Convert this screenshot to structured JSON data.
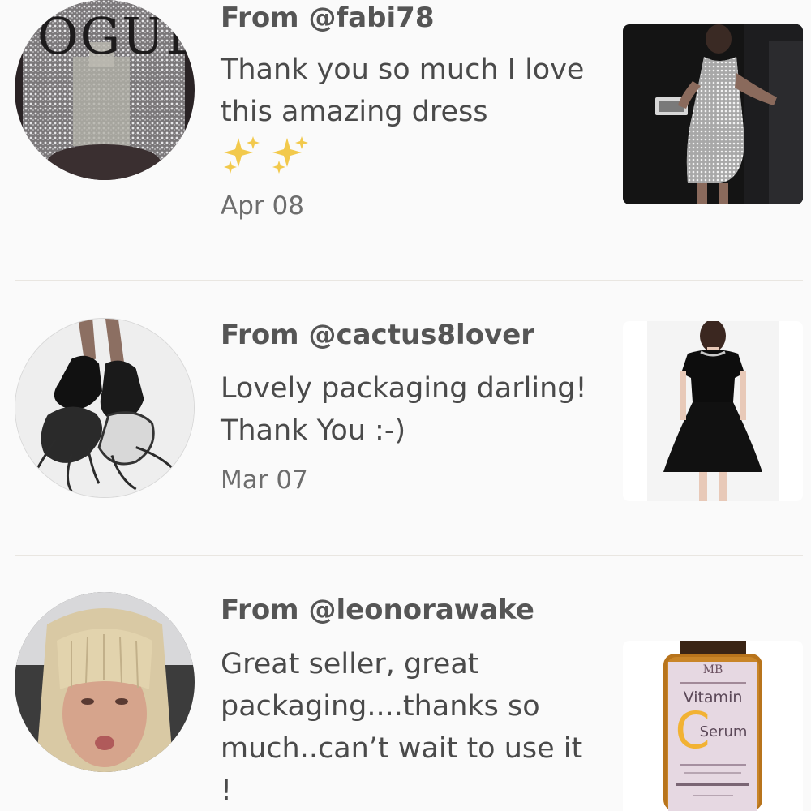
{
  "reviews": [
    {
      "from": "From @fabi78",
      "message": "Thank you so much I love this amazing dress",
      "emoji": "✨✨",
      "date": "Apr 08",
      "avatar_text": "VOGUE",
      "avatar_icon": "vogue-cover-avatar",
      "product_icon": "silver-sequin-dress-photo"
    },
    {
      "from": "From @cactus8lover",
      "message": "Lovely packaging darling! Thank You :-)",
      "date": "Mar 07",
      "avatar_icon": "sculptural-shoes-avatar",
      "product_icon": "black-dress-photo"
    },
    {
      "from": "From @leonorawake",
      "message": "Great seller, great packaging....thanks so much..can’t wait to use it !",
      "avatar_icon": "blonde-woman-avatar",
      "product_icon": "vitamin-c-serum-bottle",
      "product_brand": "MB",
      "product_line1": "Vitamin",
      "product_letter": "C",
      "product_line2": "Serum"
    }
  ],
  "colors": {
    "background": "#fafafa",
    "text": "#4a4a4a",
    "divider": "#e9e6e1",
    "sparkle": "#f2c94c"
  }
}
